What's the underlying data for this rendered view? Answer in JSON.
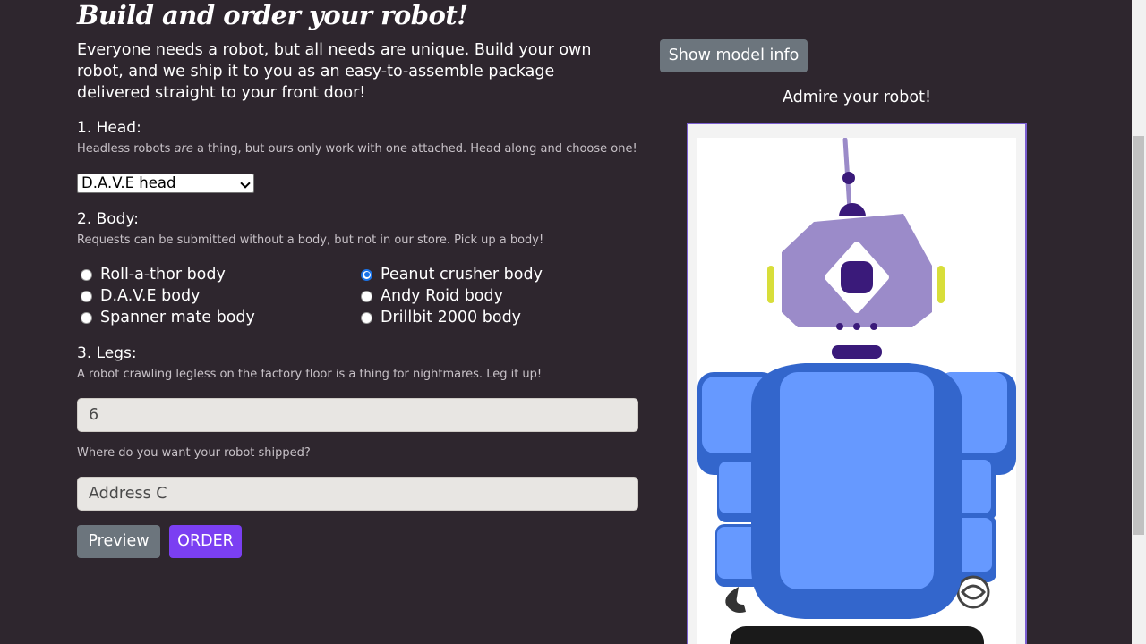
{
  "page": {
    "title": "Build and order your robot!",
    "intro": "Everyone needs a robot, but all needs are unique. Build your own robot, and we ship it to you as an easy-to-assemble package delivered straight to your front door!"
  },
  "head": {
    "label": "1. Head:",
    "help_before": "Headless robots ",
    "help_em": "are",
    "help_after": " a thing, but ours only work with one attached. Head along and choose one!",
    "selected": "D.A.V.E head"
  },
  "body": {
    "label": "2. Body:",
    "help": "Requests can be submitted without a body, but not in our store. Pick up a body!",
    "options": [
      {
        "label": "Roll-a-thor body",
        "checked": false
      },
      {
        "label": "Peanut crusher body",
        "checked": true
      },
      {
        "label": "D.A.V.E body",
        "checked": false
      },
      {
        "label": "Andy Roid body",
        "checked": false
      },
      {
        "label": "Spanner mate body",
        "checked": false
      },
      {
        "label": "Drillbit 2000 body",
        "checked": false
      }
    ]
  },
  "legs": {
    "label": "3. Legs:",
    "help": "A robot crawling legless on the factory floor is a thing for nightmares. Leg it up!",
    "value": "6"
  },
  "shipping": {
    "help": "Where do you want your robot shipped?",
    "value": "Address C"
  },
  "buttons": {
    "preview": "Preview",
    "order": "ORDER",
    "model_info": "Show model info"
  },
  "preview": {
    "caption": "Admire your robot!"
  },
  "colors": {
    "background": "#2e262e",
    "accent": "#7b3ff2",
    "secondary_button": "#6c757d",
    "robot_head": "#9b8bc9",
    "robot_body": "#6699ff",
    "robot_dark": "#3a1a7a"
  }
}
